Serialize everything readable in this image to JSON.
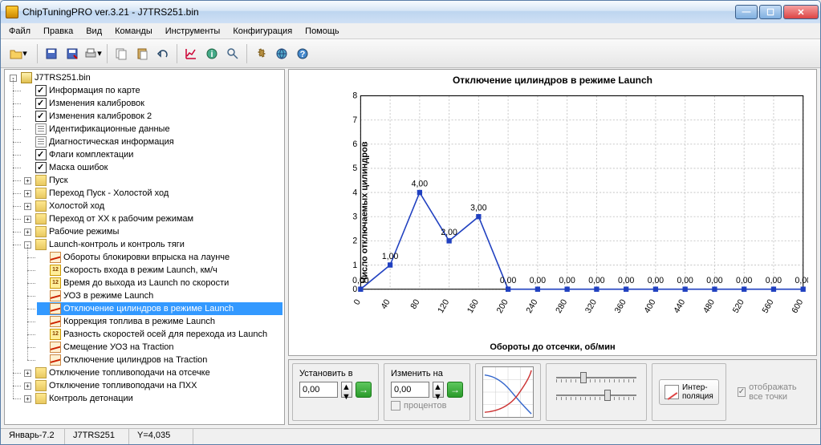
{
  "title": "ChipTuningPRO ver.3.21 - J7TRS251.bin",
  "menu": [
    "Файл",
    "Правка",
    "Вид",
    "Команды",
    "Инструменты",
    "Конфигурация",
    "Помощь"
  ],
  "tree": {
    "root": "J7TRS251.bin",
    "top_items": [
      {
        "label": "Информация по карте",
        "icon": "check"
      },
      {
        "label": "Изменения калибровок",
        "icon": "check"
      },
      {
        "label": "Изменения калибровок 2",
        "icon": "check"
      },
      {
        "label": "Идентификационные данные",
        "icon": "page"
      },
      {
        "label": "Диагностическая информация",
        "icon": "page"
      },
      {
        "label": "Флаги комплектации",
        "icon": "check"
      },
      {
        "label": "Маска ошибок",
        "icon": "check"
      }
    ],
    "folders_before": [
      "Пуск",
      "Переход Пуск - Холостой ход",
      "Холостой ход",
      "Переход от ХХ к рабочим режимам",
      "Рабочие режимы"
    ],
    "launch_folder": "Launch-контроль и контроль тяги",
    "launch_items": [
      {
        "label": "Обороты блокировки впрыска на лаунче",
        "icon": "wave"
      },
      {
        "label": "Скорость входа в режим Launch, км/ч",
        "icon": "val12"
      },
      {
        "label": "Время до выхода из Launch по скорости",
        "icon": "val12"
      },
      {
        "label": "УОЗ в режиме Launch",
        "icon": "wave"
      },
      {
        "label": "Отключение цилиндров в режиме Launch",
        "icon": "wave",
        "sel": true
      },
      {
        "label": "Коррекция топлива в режиме Launch",
        "icon": "wave"
      },
      {
        "label": "Разность скоростей осей для перехода из Launch",
        "icon": "val12"
      },
      {
        "label": "Смещение УОЗ на Traction",
        "icon": "wave"
      },
      {
        "label": "Отключение цилиндров на Traction",
        "icon": "wave"
      }
    ],
    "folders_after": [
      "Отключение топливоподачи на отсечке",
      "Отключение топливоподачи на ПХХ",
      "Контроль детонации"
    ]
  },
  "chart_data": {
    "type": "line",
    "title": "Отключение цилиндров в режиме Launch",
    "xlabel": "Обороты до отсечки, об/мин",
    "ylabel": "Число отключаемых цилиндров",
    "x": [
      0,
      40,
      80,
      120,
      160,
      200,
      240,
      280,
      320,
      360,
      400,
      440,
      480,
      520,
      560,
      600
    ],
    "values": [
      0.0,
      1.0,
      4.0,
      2.0,
      3.0,
      0.0,
      0.0,
      0.0,
      0.0,
      0.0,
      0.0,
      0.0,
      0.0,
      0.0,
      0.0,
      0.0
    ],
    "ylim": [
      0,
      8
    ],
    "xlim": [
      0,
      600
    ]
  },
  "controls": {
    "set_label": "Установить в",
    "set_value": "0,00",
    "change_label": "Изменить на",
    "change_value": "0,00",
    "percent_label": "процентов",
    "interp_label": "Интер-\nполяция",
    "show_all_points": "отображать все точки"
  },
  "status": {
    "cell1": "Январь-7.2",
    "cell2": "J7TRS251",
    "cell3": "Y=4,035"
  }
}
